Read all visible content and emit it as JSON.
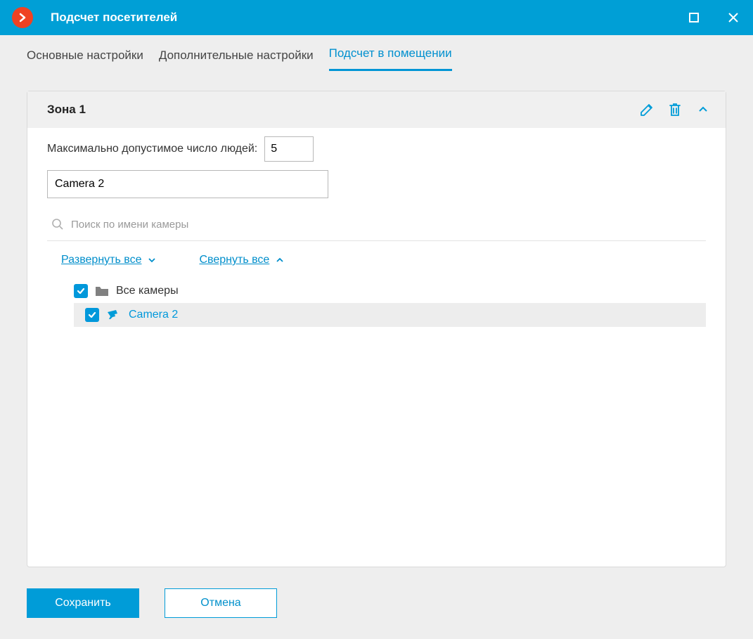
{
  "window": {
    "title": "Подсчет посетителей"
  },
  "tabs": [
    {
      "label": "Основные настройки",
      "active": false
    },
    {
      "label": "Дополнительные настройки",
      "active": false
    },
    {
      "label": "Подсчет в помещении",
      "active": true
    }
  ],
  "zone": {
    "title": "Зона 1",
    "max_people_label": "Максимально допустимое число людей:",
    "max_people_value": "5",
    "camera_name_value": "Camera 2",
    "search_placeholder": "Поиск по имени камеры",
    "expand_all": "Развернуть все",
    "collapse_all": "Свернуть все",
    "tree": {
      "root_label": "Все камеры",
      "child_label": "Camera 2"
    }
  },
  "buttons": {
    "save": "Сохранить",
    "cancel": "Отмена"
  }
}
